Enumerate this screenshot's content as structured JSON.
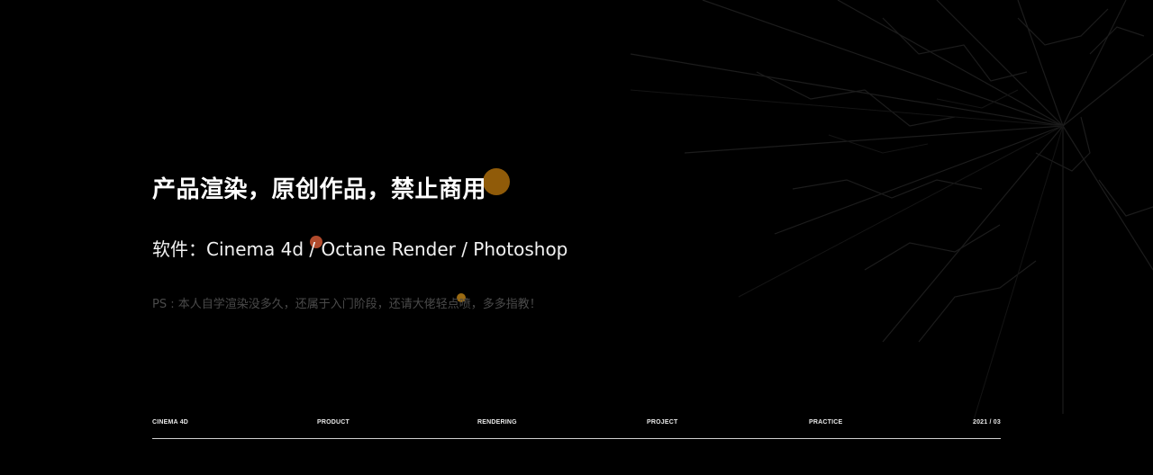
{
  "hero": {
    "title": "产品渲染，原创作品，禁止商用",
    "software": "软件：Cinema 4d / Octane Render / Photoshop",
    "note": "PS : 本人自学渲染没多久，还属于入门阶段，还请大佬轻点喷，多多指教！"
  },
  "footer": {
    "items": [
      "CINEMA 4D",
      "PRODUCT",
      "RENDERING",
      "PROJECT",
      "PRACTICE",
      "2021 / 03"
    ]
  },
  "colors": {
    "background": "#000000",
    "accent_orange": "#a0650a",
    "accent_red": "#b04a2c",
    "text_primary": "#ffffff",
    "text_muted": "#4a4a4a"
  }
}
